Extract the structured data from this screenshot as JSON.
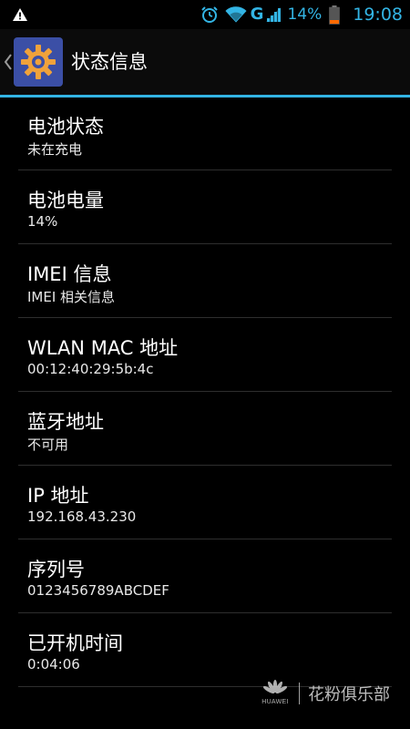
{
  "status_bar": {
    "icons": [
      "warning-icon",
      "alarm-icon",
      "wifi-icon",
      "signal-icon",
      "battery-icon"
    ],
    "network_type": "G",
    "battery_percent": "14%",
    "time": "19:08",
    "accent_color": "#33b5e5"
  },
  "action_bar": {
    "title": "状态信息",
    "icons": [
      "back-icon",
      "settings-gear-icon"
    ]
  },
  "items": [
    {
      "title": "电池状态",
      "summary": "未在充电"
    },
    {
      "title": "电池电量",
      "summary": "14%"
    },
    {
      "title": "IMEI 信息",
      "summary": "IMEI 相关信息"
    },
    {
      "title": "WLAN MAC 地址",
      "summary": "00:12:40:29:5b:4c"
    },
    {
      "title": "蓝牙地址",
      "summary": "不可用"
    },
    {
      "title": "IP 地址",
      "summary": "192.168.43.230"
    },
    {
      "title": "序列号",
      "summary": "0123456789ABCDEF"
    },
    {
      "title": "已开机时间",
      "summary": "0:04:06"
    }
  ],
  "watermark": {
    "brand": "HUAWEI",
    "text": "花粉俱乐部"
  }
}
